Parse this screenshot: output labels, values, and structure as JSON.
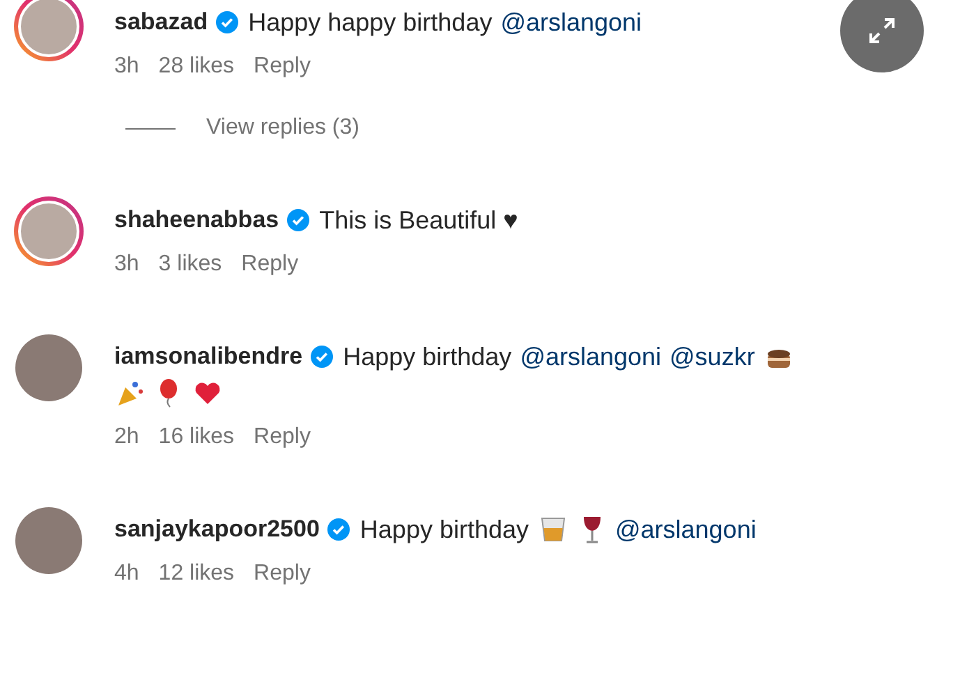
{
  "comments": [
    {
      "username": "sabazad",
      "verified": true,
      "story_ring": true,
      "lines": [
        [
          {
            "kind": "text",
            "text": "Happy happy birthday"
          },
          {
            "kind": "mention",
            "text": "@arslangoni"
          }
        ]
      ],
      "time": "3h",
      "likes": "28 likes",
      "reply": "Reply",
      "view_replies": "View replies (3)"
    },
    {
      "username": "shaheenabbas",
      "verified": true,
      "story_ring": true,
      "lines": [
        [
          {
            "kind": "text",
            "text": "This is Beautiful ♥"
          }
        ]
      ],
      "time": "3h",
      "likes": "3 likes",
      "reply": "Reply"
    },
    {
      "username": "iamsonalibendre",
      "verified": true,
      "story_ring": false,
      "lines": [
        [
          {
            "kind": "text",
            "text": "Happy birthday"
          },
          {
            "kind": "mention",
            "text": "@arslangoni"
          },
          {
            "kind": "mention",
            "text": "@suzkr"
          },
          {
            "kind": "cake"
          }
        ],
        [
          {
            "kind": "popper"
          },
          {
            "kind": "balloon"
          },
          {
            "kind": "heart"
          }
        ]
      ],
      "time": "2h",
      "likes": "16 likes",
      "reply": "Reply"
    },
    {
      "username": "sanjaykapoor2500",
      "verified": true,
      "story_ring": false,
      "lines": [
        [
          {
            "kind": "text",
            "text": "Happy birthday"
          },
          {
            "kind": "tumbler"
          },
          {
            "kind": "wine"
          },
          {
            "kind": "mention",
            "text": "@arslangoni"
          }
        ]
      ],
      "time": "4h",
      "likes": "12 likes",
      "reply": "Reply"
    }
  ]
}
